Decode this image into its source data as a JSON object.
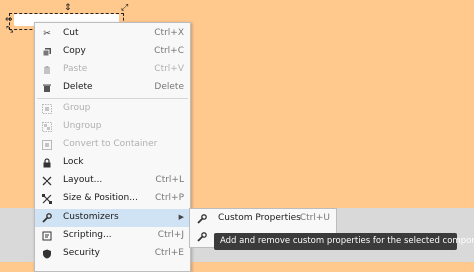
{
  "menu": {
    "items": [
      {
        "label": "Cut",
        "shortcut": "Ctrl+X",
        "icon": "scissors-icon",
        "disabled": false
      },
      {
        "label": "Copy",
        "shortcut": "Ctrl+C",
        "icon": "copy-icon",
        "disabled": false
      },
      {
        "label": "Paste",
        "shortcut": "Ctrl+V",
        "icon": "paste-icon",
        "disabled": true
      },
      {
        "label": "Delete",
        "shortcut": "Delete",
        "icon": "trash-icon",
        "disabled": false
      },
      {
        "label": "Group",
        "shortcut": "",
        "icon": "group-icon",
        "disabled": true
      },
      {
        "label": "Ungroup",
        "shortcut": "",
        "icon": "ungroup-icon",
        "disabled": true
      },
      {
        "label": "Convert to Container",
        "shortcut": "",
        "icon": "container-icon",
        "disabled": true
      },
      {
        "label": "Lock",
        "shortcut": "",
        "icon": "lock-icon",
        "disabled": false
      },
      {
        "label": "Layout...",
        "shortcut": "Ctrl+L",
        "icon": "layout-icon",
        "disabled": false
      },
      {
        "label": "Size & Position...",
        "shortcut": "Ctrl+P",
        "icon": "size-position-icon",
        "disabled": false
      },
      {
        "label": "Customizers",
        "shortcut": "",
        "icon": "wrench-icon",
        "disabled": false,
        "submenu": true
      },
      {
        "label": "Scripting...",
        "shortcut": "Ctrl+J",
        "icon": "script-icon",
        "disabled": false
      },
      {
        "label": "Security",
        "shortcut": "Ctrl+E",
        "icon": "shield-icon",
        "disabled": false
      }
    ]
  },
  "submenu": {
    "items": [
      {
        "label": "Custom Properties",
        "shortcut": "Ctrl+U",
        "icon": "wrench-icon"
      }
    ]
  },
  "tooltip": {
    "text": "Add and remove custom properties for the selected component."
  },
  "colors": {
    "canvas": "#ffc98e",
    "highlight": "#cfe3f5",
    "tooltip_bg": "#3b3b3b"
  }
}
